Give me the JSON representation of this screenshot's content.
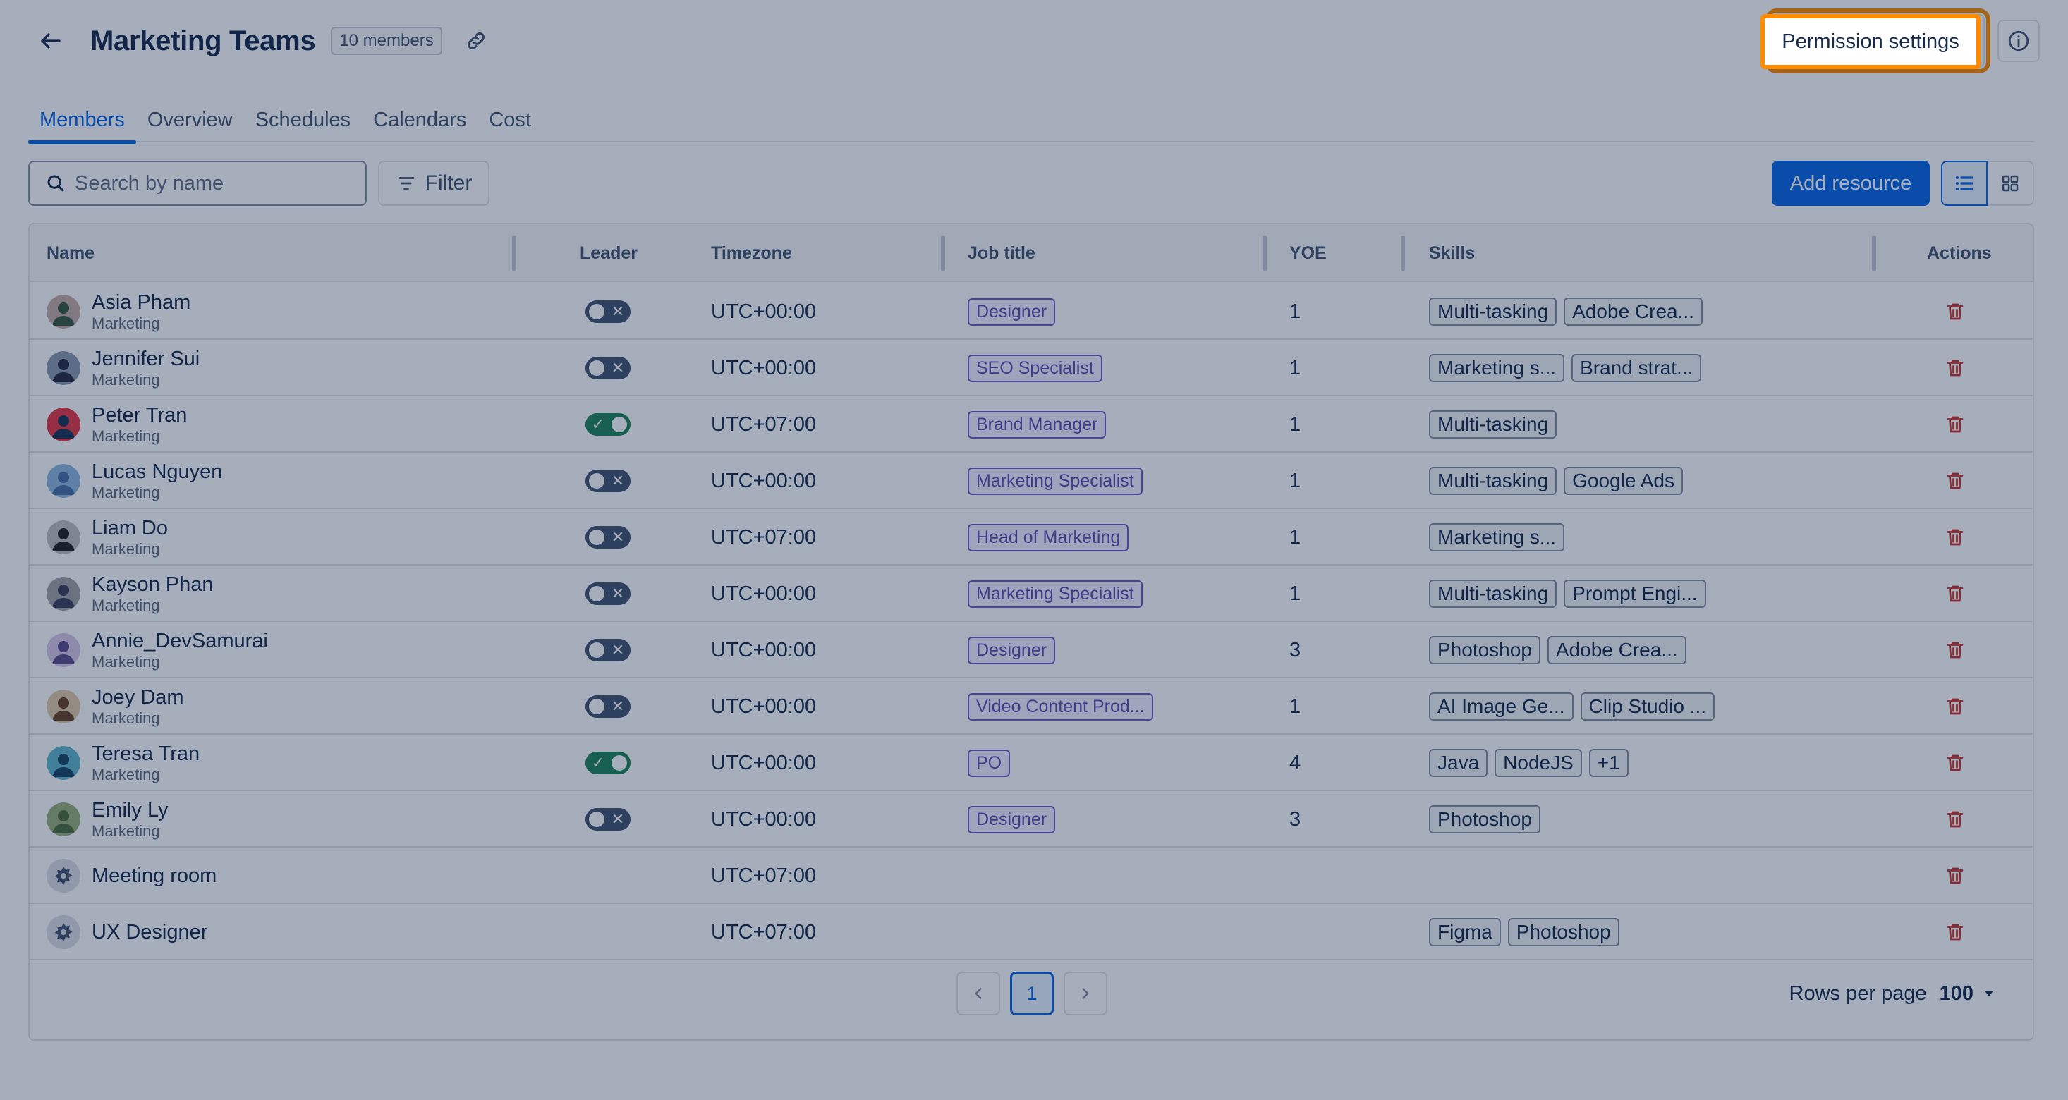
{
  "header": {
    "title": "Marketing Teams",
    "members_badge": "10 members",
    "permission_settings_label": "Permission settings"
  },
  "tabs": [
    {
      "label": "Members",
      "active": true
    },
    {
      "label": "Overview"
    },
    {
      "label": "Schedules"
    },
    {
      "label": "Calendars"
    },
    {
      "label": "Cost"
    }
  ],
  "toolbar": {
    "search_placeholder": "Search by name",
    "filter_label": "Filter",
    "add_resource_label": "Add resource"
  },
  "table": {
    "columns": [
      "Name",
      "Leader",
      "Timezone",
      "Job title",
      "YOE",
      "Skills",
      "Actions"
    ],
    "rows": [
      {
        "name": "Asia Pham",
        "team": "Marketing",
        "leader": false,
        "timezone": "UTC+00:00",
        "job_title": "Designer",
        "yoe": "1",
        "skills": [
          "Multi-tasking",
          "Adobe Crea..."
        ]
      },
      {
        "name": "Jennifer Sui",
        "team": "Marketing",
        "leader": false,
        "timezone": "UTC+00:00",
        "job_title": "SEO Specialist",
        "yoe": "1",
        "skills": [
          "Marketing s...",
          "Brand strat..."
        ]
      },
      {
        "name": "Peter Tran",
        "team": "Marketing",
        "leader": true,
        "timezone": "UTC+07:00",
        "job_title": "Brand Manager",
        "yoe": "1",
        "skills": [
          "Multi-tasking"
        ]
      },
      {
        "name": "Lucas Nguyen",
        "team": "Marketing",
        "leader": false,
        "timezone": "UTC+00:00",
        "job_title": "Marketing Specialist",
        "yoe": "1",
        "skills": [
          "Multi-tasking",
          "Google Ads"
        ]
      },
      {
        "name": "Liam Do",
        "team": "Marketing",
        "leader": false,
        "timezone": "UTC+07:00",
        "job_title": "Head of Marketing",
        "yoe": "1",
        "skills": [
          "Marketing s..."
        ]
      },
      {
        "name": "Kayson Phan",
        "team": "Marketing",
        "leader": false,
        "timezone": "UTC+00:00",
        "job_title": "Marketing Specialist",
        "yoe": "1",
        "skills": [
          "Multi-tasking",
          "Prompt Engi..."
        ]
      },
      {
        "name": "Annie_DevSamurai",
        "team": "Marketing",
        "leader": false,
        "timezone": "UTC+00:00",
        "job_title": "Designer",
        "yoe": "3",
        "skills": [
          "Photoshop",
          "Adobe Crea..."
        ]
      },
      {
        "name": "Joey Dam",
        "team": "Marketing",
        "leader": false,
        "timezone": "UTC+00:00",
        "job_title": "Video Content Prod...",
        "yoe": "1",
        "skills": [
          "AI Image Ge...",
          "Clip Studio ..."
        ]
      },
      {
        "name": "Teresa Tran",
        "team": "Marketing",
        "leader": true,
        "timezone": "UTC+00:00",
        "job_title": "PO",
        "yoe": "4",
        "skills": [
          "Java",
          "NodeJS",
          "+1"
        ]
      },
      {
        "name": "Emily Ly",
        "team": "Marketing",
        "leader": false,
        "timezone": "UTC+00:00",
        "job_title": "Designer",
        "yoe": "3",
        "skills": [
          "Photoshop"
        ]
      },
      {
        "name": "Meeting room",
        "team": "",
        "leader": null,
        "timezone": "UTC+07:00",
        "job_title": "",
        "yoe": "",
        "skills": [],
        "resource": true
      },
      {
        "name": "UX Designer",
        "team": "",
        "leader": null,
        "timezone": "UTC+07:00",
        "job_title": "",
        "yoe": "",
        "skills": [
          "Figma",
          "Photoshop"
        ],
        "resource": true
      }
    ]
  },
  "pagination": {
    "current_page": "1",
    "rows_per_page_label": "Rows per page",
    "rows_per_page_value": "100"
  },
  "colors": {
    "accent": "#0c66e4",
    "highlight": "#ff8b00",
    "danger": "#c9372c",
    "toggle_on": "#1f845a",
    "job_tag": "#6e5dc6"
  }
}
